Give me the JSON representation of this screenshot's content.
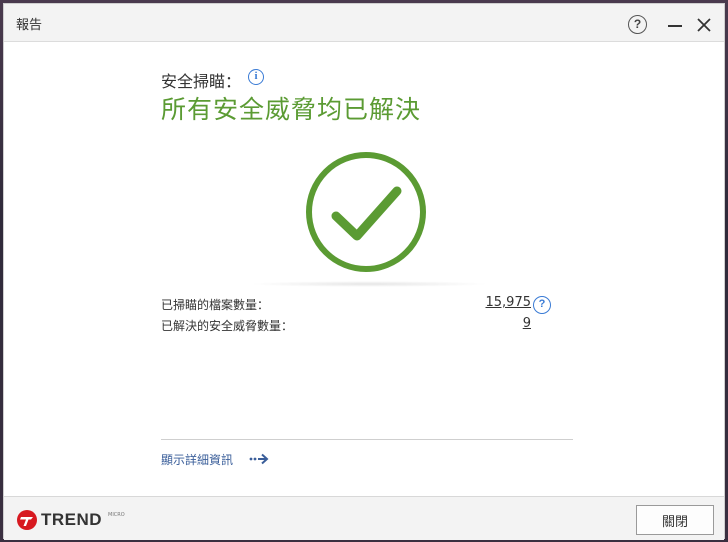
{
  "window": {
    "title": "報告",
    "help_glyph": "?"
  },
  "report": {
    "scan_label": "安全掃瞄：",
    "headline": "所有安全威脅均已解決",
    "stats": [
      {
        "label": "已掃瞄的檔案數量：",
        "value": "15,975"
      },
      {
        "label": "已解決的安全威脅數量：",
        "value": "9"
      }
    ],
    "details_link": "顯示詳細資訊",
    "status_color": "#5b9b33"
  },
  "footer": {
    "brand": "TREND",
    "brand_sub": "MICRO",
    "close_label": "關閉"
  },
  "icons": {
    "info": "i",
    "help": "?"
  }
}
